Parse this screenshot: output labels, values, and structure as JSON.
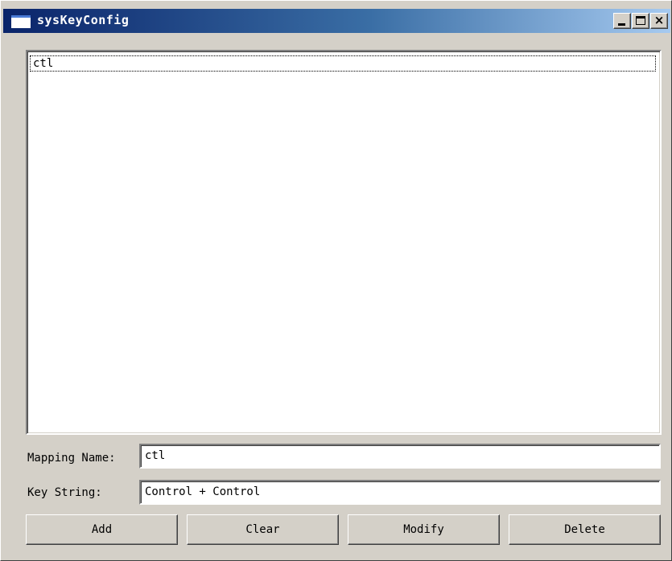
{
  "window": {
    "title": "sysKeyConfig",
    "controls": {
      "minimize_icon": "minimize-icon",
      "maximize_icon": "maximize-icon",
      "close_icon": "close-icon",
      "close_glyph": "×"
    }
  },
  "mappings": {
    "items": [
      {
        "label": "ctl"
      }
    ],
    "selected_index": 0
  },
  "form": {
    "mapping_name_label": "Mapping Name:",
    "mapping_name_value": "ctl",
    "key_string_label": "Key String:",
    "key_string_value": "Control + Control"
  },
  "buttons": {
    "add": "Add",
    "clear": "Clear",
    "modify": "Modify",
    "delete": "Delete"
  },
  "colors": {
    "window_face": "#d4d0c8",
    "titlebar_start": "#0a246a",
    "titlebar_end": "#a6caf0",
    "field_background": "#ffffff"
  }
}
